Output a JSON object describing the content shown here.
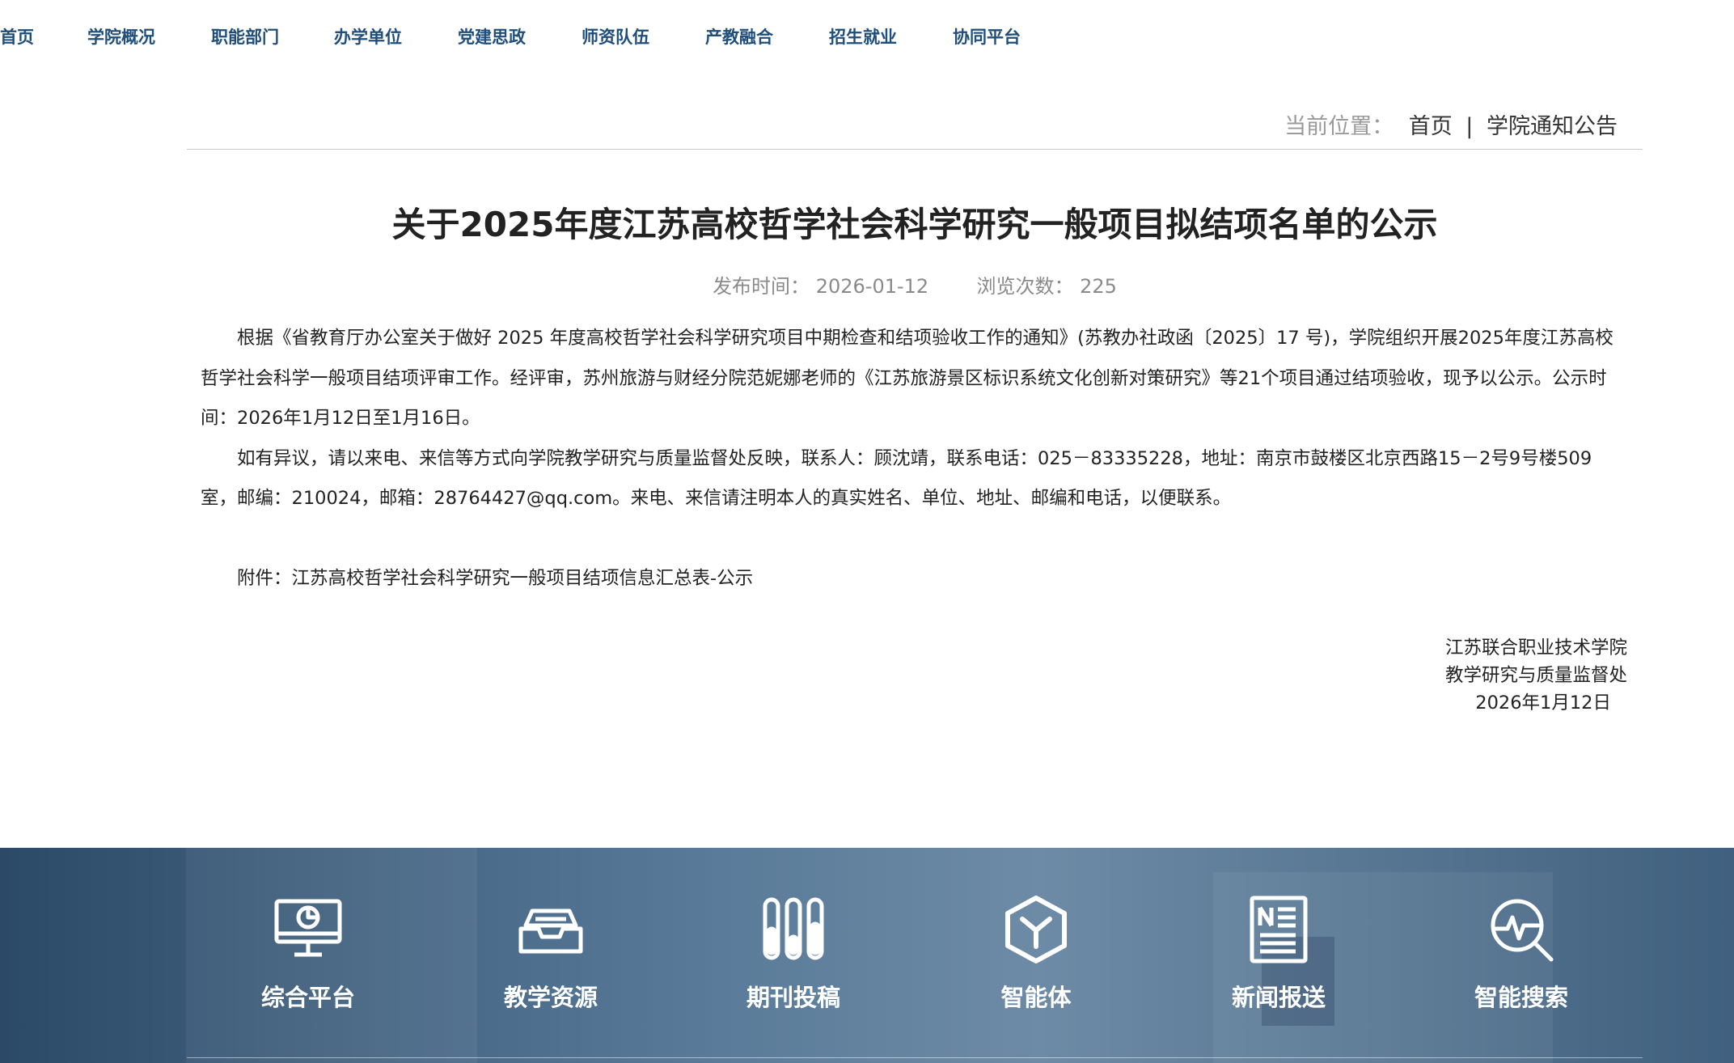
{
  "nav": {
    "items": [
      "首页",
      "学院概况",
      "职能部门",
      "办学单位",
      "党建思政",
      "师资队伍",
      "产教融合",
      "招生就业",
      "协同平台"
    ]
  },
  "breadcrumb": {
    "label": "当前位置：",
    "home": "首页",
    "separator": "|",
    "current": "学院通知公告"
  },
  "article": {
    "title": "关于2025年度江苏高校哲学社会科学研究一般项目拟结项名单的公示",
    "publish_label": "发布时间：",
    "publish_date": "2026-01-12",
    "views_label": "浏览次数：",
    "views": "225",
    "paragraphs": [
      "根据《省教育厅办公室关于做好 2025 年度高校哲学社会科学研究项目中期检查和结项验收工作的通知》(苏教办社政函〔2025〕17 号)，学院组织开展2025年度江苏高校哲学社会科学一般项目结项评审工作。经评审，苏州旅游与财经分院范妮娜老师的《江苏旅游景区标识系统文化创新对策研究》等21个项目通过结项验收，现予以公示。公示时间：2026年1月12日至1月16日。",
      "如有异议，请以来电、来信等方式向学院教学研究与质量监督处反映，联系人：顾沈靖，联系电话：025－83335228，地址：南京市鼓楼区北京西路15－2号9号楼509室，邮编：210024，邮箱：28764427@qq.com。来电、来信请注明本人的真实姓名、单位、地址、邮编和电话，以便联系。"
    ],
    "attachment_label": "附件：",
    "attachment_link": "江苏高校哲学社会科学研究一般项目结项信息汇总表-公示",
    "signature": {
      "org": "江苏联合职业技术学院",
      "dept": "教学研究与质量监督处",
      "date": "2026年1月12日"
    }
  },
  "footer": {
    "links": [
      {
        "label": "综合平台",
        "icon": "monitor-chart-icon"
      },
      {
        "label": "教学资源",
        "icon": "inbox-tray-icon"
      },
      {
        "label": "期刊投稿",
        "icon": "test-tubes-icon"
      },
      {
        "label": "智能体",
        "icon": "hexagon-y-icon"
      },
      {
        "label": "新闻报送",
        "icon": "newspaper-icon"
      },
      {
        "label": "智能搜索",
        "icon": "search-pulse-icon"
      }
    ]
  },
  "colors": {
    "nav_text": "#1f4e7a",
    "footer_bg": "#3f607e",
    "meta_text": "#8a8a8a"
  }
}
